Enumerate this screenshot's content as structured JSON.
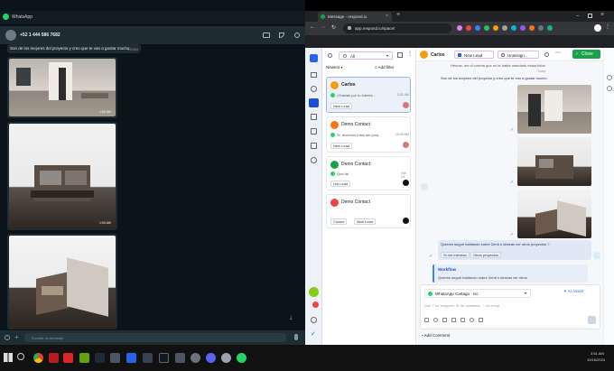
{
  "whatsapp": {
    "app_title": "WhatsApp",
    "contact": "+52 1 444 586 7682",
    "message_text": "Son de los mejores del proyecto y creo que te van a gustar mucho",
    "message_time": "1:53AM",
    "image_times": [
      "1:53 AM",
      "1:53 AM"
    ],
    "input_placeholder": "Escribe un mensaje"
  },
  "browser": {
    "tab_title": "Message - respond.io",
    "url": "app.respond.io/space/",
    "close_button": "Close"
  },
  "respond": {
    "channel_filter": "All",
    "sort": "Newest",
    "add_filter": "Add filter",
    "contact_name": "Carlos",
    "lifecycle": "New Lead",
    "assignee": "Unassign...",
    "conversations": [
      {
        "name": "Carlos",
        "preview": "¡Gracias por tu interés ...",
        "time": "3:31 AM",
        "tag": "New Lead"
      },
      {
        "name": "Demo Contact",
        "preview": "Si, tenemos fotos del proy...",
        "time": "10:05 AM",
        "tag": "New Lead"
      },
      {
        "name": "Demo Contact",
        "preview": "Que fal",
        "time": "Oct 13",
        "tag": "Hot Lead"
      },
      {
        "name": "Demo Contact",
        "preview": "",
        "time": "",
        "tag": "Closed",
        "tag2": "New Lead"
      }
    ],
    "msg_top": "Hemos, me di cuenta que no te habia mandado estas fotos",
    "today_label": "Today",
    "msg_caption": "Son de los mejores del proyecto y creo que te van a gustar mucho",
    "question": "Quieres seguir hablando sobre Zenit o deseas ver otros proyectos ?",
    "btn1": "Si me interesa",
    "btn2": "Otros proyectos",
    "workflow_title": "Workflow",
    "workflow_text": "Quieres seguir hablando sobre Zenit o deseas ver otros",
    "channel_select": "WhatsApp Cartago - Isc",
    "ai_assist": "AI Assist",
    "composer_placeholder": "Use '/' for snippets, '$' for variables, ':' for emoji",
    "add_comment": "Add Comment"
  },
  "taskbar": {
    "time": "3:51 AM",
    "date": "10/16/2024"
  }
}
